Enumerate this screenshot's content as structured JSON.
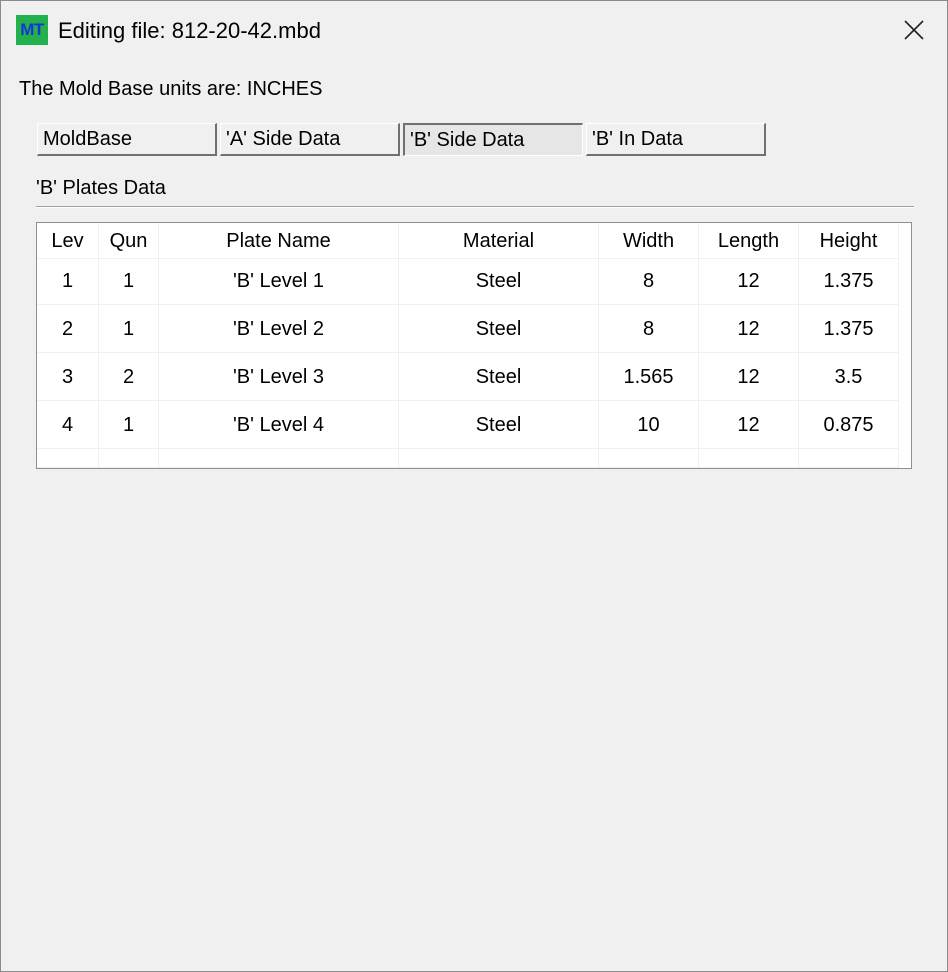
{
  "window": {
    "icon_text": "MT",
    "title": "Editing file: 812-20-42.mbd"
  },
  "units_label": "The Mold Base units are: INCHES",
  "tabs": [
    {
      "label": "MoldBase",
      "active": false
    },
    {
      "label": "'A' Side Data",
      "active": false
    },
    {
      "label": "'B' Side Data",
      "active": true
    },
    {
      "label": "'B' In Data",
      "active": false
    }
  ],
  "section_label": "'B' Plates Data",
  "table": {
    "columns": [
      "Lev",
      "Qun",
      "Plate Name",
      "Material",
      "Width",
      "Length",
      "Height"
    ],
    "rows": [
      [
        "1",
        "1",
        "'B' Level 1",
        "Steel",
        "8",
        "12",
        "1.375"
      ],
      [
        "2",
        "1",
        "'B' Level 2",
        "Steel",
        "8",
        "12",
        "1.375"
      ],
      [
        "3",
        "2",
        "'B' Level 3",
        "Steel",
        "1.565",
        "12",
        "3.5"
      ],
      [
        "4",
        "1",
        "'B' Level 4",
        "Steel",
        "10",
        "12",
        "0.875"
      ]
    ]
  }
}
